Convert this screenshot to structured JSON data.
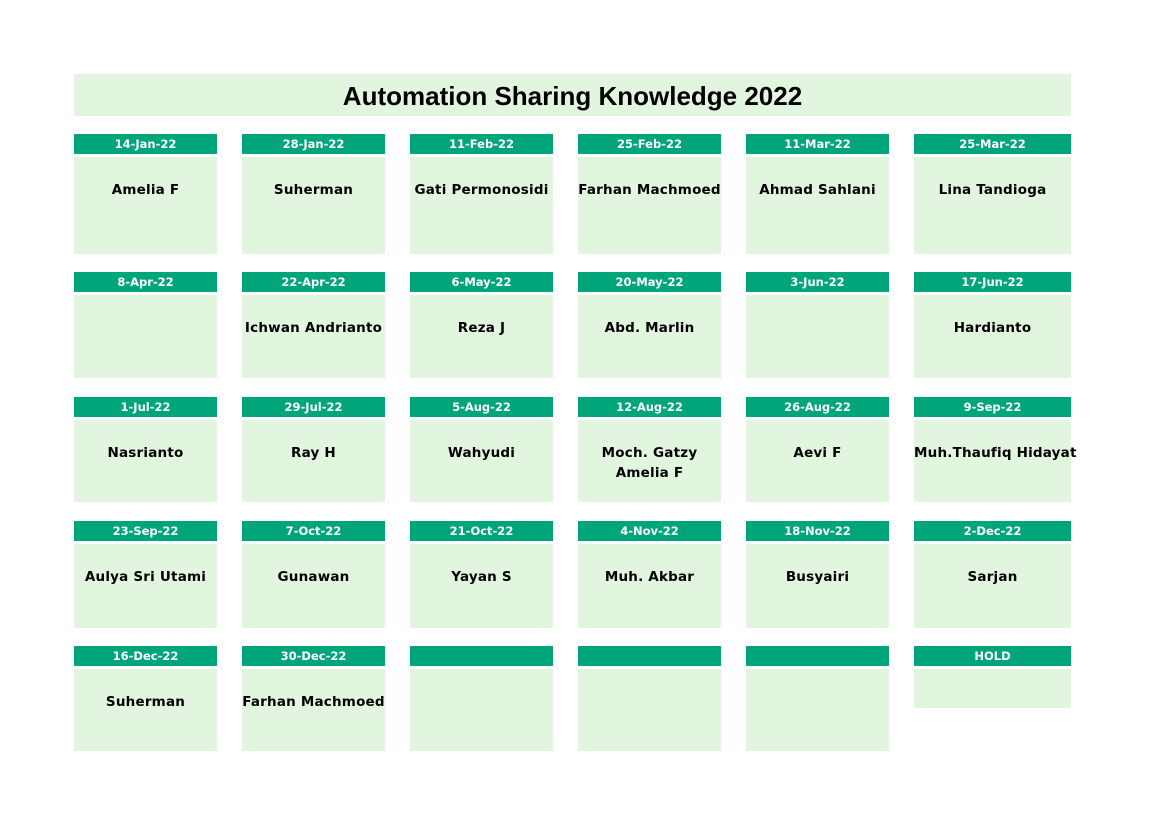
{
  "title": "Automation Sharing Knowledge 2022",
  "colors": {
    "header": "#00a57a",
    "cell_bg": "#e2f5df"
  },
  "rows": [
    [
      {
        "date": "14-Jan-22",
        "names": [
          "Amelia F"
        ]
      },
      {
        "date": "28-Jan-22",
        "names": [
          "Suherman"
        ]
      },
      {
        "date": "11-Feb-22",
        "names": [
          "Gati Permonosidi"
        ]
      },
      {
        "date": "25-Feb-22",
        "names": [
          "Farhan Machmoed"
        ]
      },
      {
        "date": "11-Mar-22",
        "names": [
          "Ahmad Sahlani"
        ]
      },
      {
        "date": "25-Mar-22",
        "names": [
          "Lina Tandioga"
        ]
      }
    ],
    [
      {
        "date": "8-Apr-22",
        "names": []
      },
      {
        "date": "22-Apr-22",
        "names": [
          "Ichwan Andrianto"
        ]
      },
      {
        "date": "6-May-22",
        "names": [
          "Reza J"
        ]
      },
      {
        "date": "20-May-22",
        "names": [
          "Abd. Marlin"
        ]
      },
      {
        "date": "3-Jun-22",
        "names": []
      },
      {
        "date": "17-Jun-22",
        "names": [
          "Hardianto"
        ]
      }
    ],
    [
      {
        "date": "1-Jul-22",
        "names": [
          "Nasrianto"
        ]
      },
      {
        "date": "29-Jul-22",
        "names": [
          "Ray H"
        ]
      },
      {
        "date": "5-Aug-22",
        "names": [
          "Wahyudi"
        ]
      },
      {
        "date": "12-Aug-22",
        "names": [
          "Moch. Gatzy",
          "Amelia F"
        ]
      },
      {
        "date": "26-Aug-22",
        "names": [
          "Aevi F"
        ]
      },
      {
        "date": "9-Sep-22",
        "names": [
          "Muh.Thaufiq Hidayat"
        ]
      }
    ],
    [
      {
        "date": "23-Sep-22",
        "names": [
          "Aulya Sri Utami"
        ]
      },
      {
        "date": "7-Oct-22",
        "names": [
          "Gunawan"
        ]
      },
      {
        "date": "21-Oct-22",
        "names": [
          "Yayan S"
        ]
      },
      {
        "date": "4-Nov-22",
        "names": [
          "Muh. Akbar"
        ]
      },
      {
        "date": "18-Nov-22",
        "names": [
          "Busyairi"
        ]
      },
      {
        "date": "2-Dec-22",
        "names": [
          "Sarjan"
        ]
      }
    ],
    [
      {
        "date": "16-Dec-22",
        "names": [
          "Suherman"
        ]
      },
      {
        "date": "30-Dec-22",
        "names": [
          "Farhan Machmoed"
        ]
      },
      {
        "date": "",
        "names": []
      },
      {
        "date": "",
        "names": []
      },
      {
        "date": "",
        "names": []
      },
      {
        "date": "HOLD",
        "names": []
      }
    ]
  ]
}
